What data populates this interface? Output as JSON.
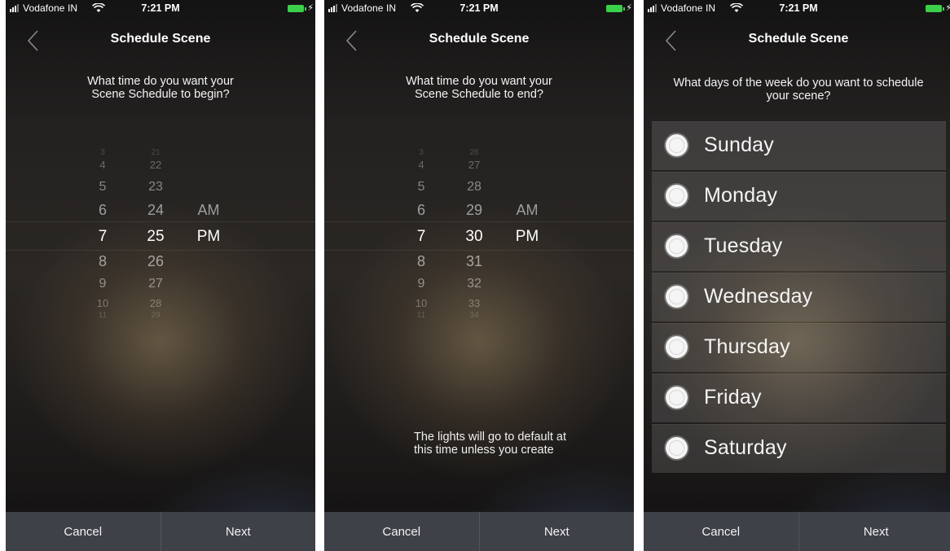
{
  "status_bar": {
    "carrier": "Vodafone IN",
    "time": "7:21 PM",
    "battery_color": "#3bd04a",
    "bolt": "⚡"
  },
  "screen_start": {
    "title": "Schedule Scene",
    "question_line1": "What time do you want your",
    "question_line2": "Scene Schedule to begin?",
    "hours": [
      "3",
      "4",
      "5",
      "6",
      "7",
      "8",
      "9",
      "10",
      "11"
    ],
    "minutes": [
      "21",
      "22",
      "23",
      "24",
      "25",
      "26",
      "27",
      "28",
      "29"
    ],
    "period": [
      "AM",
      "PM"
    ],
    "selected_hour": "7",
    "selected_minute": "25",
    "selected_period": "PM",
    "cancel_label": "Cancel",
    "next_label": "Next"
  },
  "screen_end": {
    "title": "Schedule Scene",
    "question_line1": "What time do you want your",
    "question_line2": "Scene Schedule to end?",
    "hours": [
      "3",
      "4",
      "5",
      "6",
      "7",
      "8",
      "9",
      "10",
      "11"
    ],
    "minutes": [
      "26",
      "27",
      "28",
      "29",
      "30",
      "31",
      "32",
      "33",
      "34"
    ],
    "period": [
      "AM",
      "PM"
    ],
    "selected_hour": "7",
    "selected_minute": "30",
    "selected_period": "PM",
    "note_line1": "The lights will go to default at",
    "note_line2": "this time unless you create",
    "cancel_label": "Cancel",
    "next_label": "Next"
  },
  "screen_days": {
    "title": "Schedule Scene",
    "question_line1": "What days of the week do you want to schedule",
    "question_line2": "your scene?",
    "days": [
      "Sunday",
      "Monday",
      "Tuesday",
      "Wednesday",
      "Thursday",
      "Friday",
      "Saturday"
    ],
    "cancel_label": "Cancel",
    "next_label": "Next"
  },
  "icons": {
    "back": "chevron-left-icon",
    "signal": "signal-bars-icon",
    "wifi": "wifi-icon",
    "battery": "battery-icon",
    "radio": "radio-unselected-icon"
  }
}
